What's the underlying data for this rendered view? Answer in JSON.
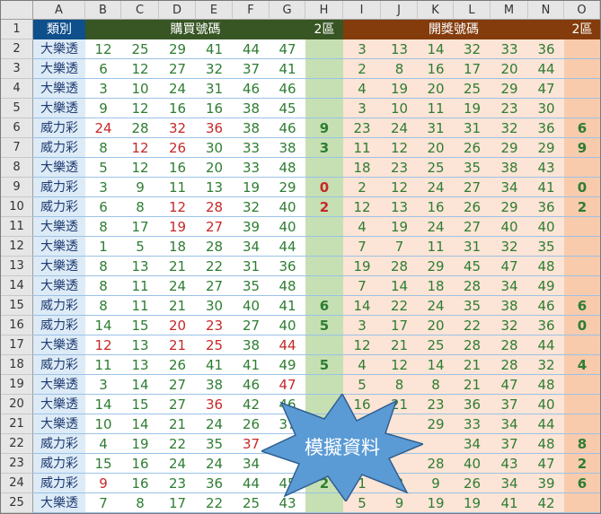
{
  "columns": [
    "A",
    "B",
    "C",
    "D",
    "E",
    "F",
    "G",
    "H",
    "I",
    "J",
    "K",
    "L",
    "M",
    "N",
    "O"
  ],
  "header_row": {
    "row_number": "1",
    "category": "類別",
    "buy_numbers": "購買號碼",
    "buy_zone2": "2區",
    "draw_numbers": "開獎號碼",
    "draw_zone2": "2區"
  },
  "colors": {
    "category_header_bg": "#0e4f8c",
    "buy_header_bg": "#375623",
    "draw_header_bg": "#843c0c",
    "category_col_bg": "#ddebf7",
    "buy_zone_bg": "#c6e0b4",
    "draw_bg": "#fce4d6",
    "draw_zone_bg": "#f8cbad",
    "number_green": "#2e7d32",
    "number_red": "#c62828",
    "starburst": "#5b9bd5"
  },
  "rows": [
    {
      "r": "2",
      "kind": "大樂透",
      "buy": [
        {
          "n": "12"
        },
        {
          "n": "25"
        },
        {
          "n": "29"
        },
        {
          "n": "41"
        },
        {
          "n": "44"
        },
        {
          "n": "47"
        }
      ],
      "bz": {
        "n": ""
      },
      "draw": [
        "3",
        "13",
        "14",
        "32",
        "33",
        "36"
      ],
      "dz": ""
    },
    {
      "r": "3",
      "kind": "大樂透",
      "buy": [
        {
          "n": "6"
        },
        {
          "n": "12"
        },
        {
          "n": "27"
        },
        {
          "n": "32"
        },
        {
          "n": "37"
        },
        {
          "n": "41"
        }
      ],
      "bz": {
        "n": ""
      },
      "draw": [
        "2",
        "8",
        "16",
        "17",
        "20",
        "44"
      ],
      "dz": ""
    },
    {
      "r": "4",
      "kind": "大樂透",
      "buy": [
        {
          "n": "3"
        },
        {
          "n": "10"
        },
        {
          "n": "24"
        },
        {
          "n": "31"
        },
        {
          "n": "46"
        },
        {
          "n": "46"
        }
      ],
      "bz": {
        "n": ""
      },
      "draw": [
        "4",
        "19",
        "20",
        "25",
        "29",
        "47"
      ],
      "dz": ""
    },
    {
      "r": "5",
      "kind": "大樂透",
      "buy": [
        {
          "n": "9"
        },
        {
          "n": "12"
        },
        {
          "n": "16"
        },
        {
          "n": "16"
        },
        {
          "n": "38"
        },
        {
          "n": "45"
        }
      ],
      "bz": {
        "n": ""
      },
      "draw": [
        "3",
        "10",
        "11",
        "19",
        "23",
        "30"
      ],
      "dz": ""
    },
    {
      "r": "6",
      "kind": "威力彩",
      "buy": [
        {
          "n": "24",
          "red": true
        },
        {
          "n": "28"
        },
        {
          "n": "32",
          "red": true
        },
        {
          "n": "36",
          "red": true
        },
        {
          "n": "38"
        },
        {
          "n": "46"
        }
      ],
      "bz": {
        "n": "9"
      },
      "draw": [
        "23",
        "24",
        "31",
        "31",
        "32",
        "36"
      ],
      "dz": "6"
    },
    {
      "r": "7",
      "kind": "威力彩",
      "buy": [
        {
          "n": "8"
        },
        {
          "n": "12",
          "red": true
        },
        {
          "n": "26",
          "red": true
        },
        {
          "n": "30"
        },
        {
          "n": "33"
        },
        {
          "n": "38"
        }
      ],
      "bz": {
        "n": "3"
      },
      "draw": [
        "11",
        "12",
        "20",
        "26",
        "29",
        "29"
      ],
      "dz": "9"
    },
    {
      "r": "8",
      "kind": "大樂透",
      "buy": [
        {
          "n": "5"
        },
        {
          "n": "12"
        },
        {
          "n": "16"
        },
        {
          "n": "20"
        },
        {
          "n": "33"
        },
        {
          "n": "48"
        }
      ],
      "bz": {
        "n": ""
      },
      "draw": [
        "18",
        "23",
        "25",
        "35",
        "38",
        "43"
      ],
      "dz": ""
    },
    {
      "r": "9",
      "kind": "威力彩",
      "buy": [
        {
          "n": "3"
        },
        {
          "n": "9"
        },
        {
          "n": "11"
        },
        {
          "n": "13"
        },
        {
          "n": "19"
        },
        {
          "n": "29"
        }
      ],
      "bz": {
        "n": "0",
        "red": true
      },
      "draw": [
        "2",
        "12",
        "24",
        "27",
        "34",
        "41"
      ],
      "dz": "0"
    },
    {
      "r": "10",
      "kind": "威力彩",
      "buy": [
        {
          "n": "6"
        },
        {
          "n": "8"
        },
        {
          "n": "12",
          "red": true
        },
        {
          "n": "28",
          "red": true
        },
        {
          "n": "32"
        },
        {
          "n": "40"
        }
      ],
      "bz": {
        "n": "2",
        "red": true
      },
      "draw": [
        "12",
        "13",
        "16",
        "26",
        "29",
        "36"
      ],
      "dz": "2"
    },
    {
      "r": "11",
      "kind": "大樂透",
      "buy": [
        {
          "n": "8"
        },
        {
          "n": "17"
        },
        {
          "n": "19",
          "red": true
        },
        {
          "n": "27",
          "red": true
        },
        {
          "n": "39"
        },
        {
          "n": "40"
        }
      ],
      "bz": {
        "n": ""
      },
      "draw": [
        "4",
        "19",
        "24",
        "27",
        "40",
        "40"
      ],
      "dz": ""
    },
    {
      "r": "12",
      "kind": "大樂透",
      "buy": [
        {
          "n": "1"
        },
        {
          "n": "5"
        },
        {
          "n": "18"
        },
        {
          "n": "28"
        },
        {
          "n": "34"
        },
        {
          "n": "44"
        }
      ],
      "bz": {
        "n": ""
      },
      "draw": [
        "7",
        "7",
        "11",
        "31",
        "32",
        "35"
      ],
      "dz": ""
    },
    {
      "r": "13",
      "kind": "大樂透",
      "buy": [
        {
          "n": "8"
        },
        {
          "n": "13"
        },
        {
          "n": "21"
        },
        {
          "n": "22"
        },
        {
          "n": "31"
        },
        {
          "n": "36"
        }
      ],
      "bz": {
        "n": ""
      },
      "draw": [
        "19",
        "28",
        "29",
        "45",
        "47",
        "48"
      ],
      "dz": ""
    },
    {
      "r": "14",
      "kind": "大樂透",
      "buy": [
        {
          "n": "8"
        },
        {
          "n": "11"
        },
        {
          "n": "24"
        },
        {
          "n": "27"
        },
        {
          "n": "35"
        },
        {
          "n": "48"
        }
      ],
      "bz": {
        "n": ""
      },
      "draw": [
        "7",
        "14",
        "18",
        "28",
        "34",
        "49"
      ],
      "dz": ""
    },
    {
      "r": "15",
      "kind": "威力彩",
      "buy": [
        {
          "n": "8"
        },
        {
          "n": "11"
        },
        {
          "n": "21"
        },
        {
          "n": "30"
        },
        {
          "n": "40"
        },
        {
          "n": "41"
        }
      ],
      "bz": {
        "n": "6"
      },
      "draw": [
        "14",
        "22",
        "24",
        "35",
        "38",
        "46"
      ],
      "dz": "6"
    },
    {
      "r": "16",
      "kind": "威力彩",
      "buy": [
        {
          "n": "14"
        },
        {
          "n": "15"
        },
        {
          "n": "20",
          "red": true
        },
        {
          "n": "23",
          "red": true
        },
        {
          "n": "27"
        },
        {
          "n": "40"
        }
      ],
      "bz": {
        "n": "5"
      },
      "draw": [
        "3",
        "17",
        "20",
        "22",
        "32",
        "36"
      ],
      "dz": "0"
    },
    {
      "r": "17",
      "kind": "大樂透",
      "buy": [
        {
          "n": "12",
          "red": true
        },
        {
          "n": "13"
        },
        {
          "n": "21",
          "red": true
        },
        {
          "n": "25",
          "red": true
        },
        {
          "n": "38"
        },
        {
          "n": "44",
          "red": true
        }
      ],
      "bz": {
        "n": ""
      },
      "draw": [
        "12",
        "21",
        "25",
        "28",
        "28",
        "44"
      ],
      "dz": ""
    },
    {
      "r": "18",
      "kind": "威力彩",
      "buy": [
        {
          "n": "11"
        },
        {
          "n": "13"
        },
        {
          "n": "26"
        },
        {
          "n": "41"
        },
        {
          "n": "41"
        },
        {
          "n": "49"
        }
      ],
      "bz": {
        "n": "5"
      },
      "draw": [
        "4",
        "12",
        "14",
        "21",
        "28",
        "32"
      ],
      "dz": "4"
    },
    {
      "r": "19",
      "kind": "大樂透",
      "buy": [
        {
          "n": "3"
        },
        {
          "n": "14"
        },
        {
          "n": "27"
        },
        {
          "n": "38"
        },
        {
          "n": "46"
        },
        {
          "n": "47",
          "red": true
        }
      ],
      "bz": {
        "n": ""
      },
      "draw": [
        "5",
        "8",
        "8",
        "21",
        "47",
        "48"
      ],
      "dz": ""
    },
    {
      "r": "20",
      "kind": "大樂透",
      "buy": [
        {
          "n": "14"
        },
        {
          "n": "15"
        },
        {
          "n": "27"
        },
        {
          "n": "36",
          "red": true
        },
        {
          "n": "42"
        },
        {
          "n": "46"
        }
      ],
      "bz": {
        "n": ""
      },
      "draw": [
        "16",
        "21",
        "23",
        "36",
        "37",
        "40"
      ],
      "dz": ""
    },
    {
      "r": "21",
      "kind": "大樂透",
      "buy": [
        {
          "n": "10"
        },
        {
          "n": "14"
        },
        {
          "n": "21"
        },
        {
          "n": "24"
        },
        {
          "n": "26"
        },
        {
          "n": "37"
        }
      ],
      "bz": {
        "n": ""
      },
      "draw": [
        "",
        "",
        "29",
        "33",
        "34",
        "44"
      ],
      "dz": ""
    },
    {
      "r": "22",
      "kind": "威力彩",
      "buy": [
        {
          "n": "4"
        },
        {
          "n": "19"
        },
        {
          "n": "22"
        },
        {
          "n": "35"
        },
        {
          "n": "37",
          "red": true
        },
        {
          "n": ""
        }
      ],
      "bz": {
        "n": ""
      },
      "draw": [
        "",
        "",
        "",
        "34",
        "37",
        "48"
      ],
      "dz": "8"
    },
    {
      "r": "23",
      "kind": "威力彩",
      "buy": [
        {
          "n": "15"
        },
        {
          "n": "16"
        },
        {
          "n": "24"
        },
        {
          "n": "24"
        },
        {
          "n": "34"
        },
        {
          "n": ""
        }
      ],
      "bz": {
        "n": ""
      },
      "draw": [
        "",
        "",
        "28",
        "40",
        "43",
        "47"
      ],
      "dz": "2"
    },
    {
      "r": "24",
      "kind": "威力彩",
      "buy": [
        {
          "n": "9",
          "red": true
        },
        {
          "n": "16"
        },
        {
          "n": "23"
        },
        {
          "n": "36"
        },
        {
          "n": "44"
        },
        {
          "n": "45"
        }
      ],
      "bz": {
        "n": "2"
      },
      "draw": [
        "1",
        "3",
        "9",
        "26",
        "34",
        "39"
      ],
      "dz": "6"
    },
    {
      "r": "25",
      "kind": "大樂透",
      "buy": [
        {
          "n": "7"
        },
        {
          "n": "8"
        },
        {
          "n": "17"
        },
        {
          "n": "22"
        },
        {
          "n": "25"
        },
        {
          "n": "43"
        }
      ],
      "bz": {
        "n": ""
      },
      "draw": [
        "5",
        "9",
        "19",
        "19",
        "41",
        "42"
      ],
      "dz": ""
    }
  ],
  "overlay_label": "模擬資料"
}
